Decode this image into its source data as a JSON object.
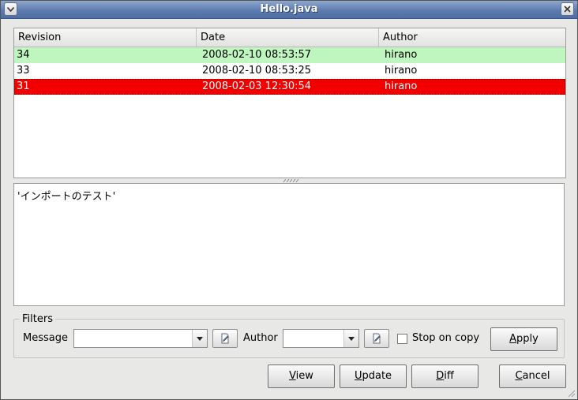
{
  "window": {
    "title": "Hello.java"
  },
  "log_table": {
    "columns": [
      "Revision",
      "Date",
      "Author"
    ],
    "rows": [
      {
        "revision": "34",
        "date": "2008-02-10 08:53:57",
        "author": "hirano",
        "state": "added"
      },
      {
        "revision": "33",
        "date": "2008-02-10 08:53:25",
        "author": "hirano",
        "state": "normal"
      },
      {
        "revision": "31",
        "date": "2008-02-03 12:30:54",
        "author": "hirano",
        "state": "selected"
      }
    ]
  },
  "message": {
    "text": "'インポートのテスト'"
  },
  "filters": {
    "legend": "Filters",
    "message_label": "Message",
    "message_value": "",
    "author_label": "Author",
    "author_value": "",
    "stop_on_copy_label": "Stop on copy",
    "stop_on_copy_checked": false,
    "apply_label_mnemonic": "A",
    "apply_label_rest": "pply"
  },
  "buttons": {
    "view_mnemonic": "V",
    "view_rest": "iew",
    "update_mnemonic": "U",
    "update_rest": "pdate",
    "diff_mnemonic": "D",
    "diff_rest": "iff",
    "cancel_mnemonic": "C",
    "cancel_rest": "ancel"
  },
  "colors": {
    "added_row": "#bff5bf",
    "selected_row": "#f20000",
    "titlebar": "#5d7cb0"
  }
}
